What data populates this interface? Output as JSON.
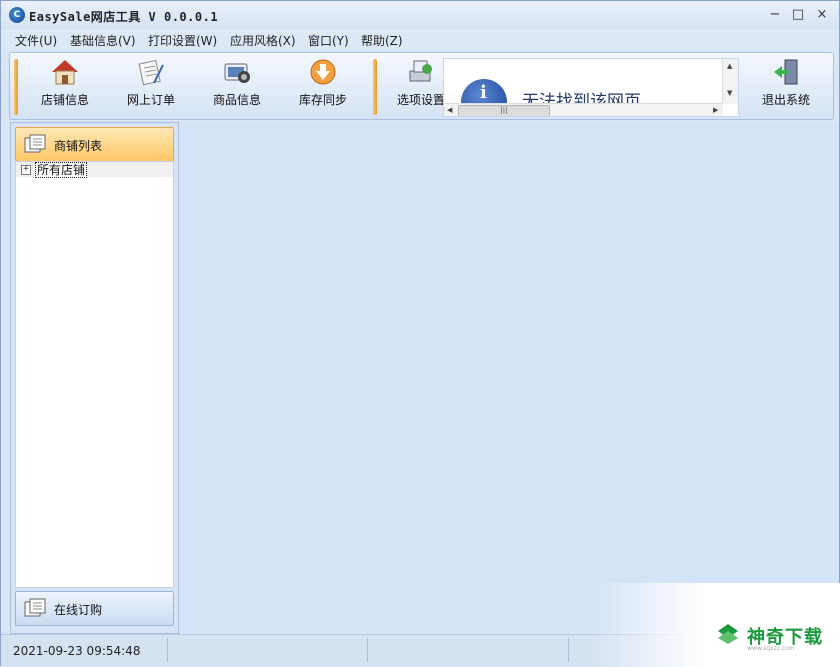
{
  "window": {
    "title": "EasySale网店工具 V 0.0.0.1",
    "app_icon_text": "C",
    "controls": {
      "minimize": "−",
      "maximize": "□",
      "close": "×"
    }
  },
  "menu": {
    "items": [
      "文件(U)",
      "基础信息(V)",
      "打印设置(W)",
      "应用风格(X)",
      "窗口(Y)",
      "帮助(Z)"
    ]
  },
  "toolbar": {
    "buttons": [
      {
        "label": "店铺信息",
        "icon": "house-icon"
      },
      {
        "label": "网上订单",
        "icon": "order-doc-icon"
      },
      {
        "label": "商品信息",
        "icon": "product-icon"
      },
      {
        "label": "库存同步",
        "icon": "sync-arrow-icon"
      },
      {
        "label": "选项设置",
        "icon": "settings-icon"
      },
      {
        "label": "退出系统",
        "icon": "exit-door-icon"
      }
    ],
    "web_panel": {
      "error_text": "无法找到该网页",
      "scroll_thumb": "|||"
    }
  },
  "left_panel": {
    "header_label": "商铺列表",
    "tree": [
      {
        "label": "所有店铺",
        "expander": "+"
      }
    ],
    "bottom_button_label": "在线订购"
  },
  "status": {
    "datetime": "2021-09-23 09:54:48"
  },
  "watermark": {
    "text": "神奇下载",
    "sub": "www.sqxzz.com"
  },
  "colors": {
    "accent_orange": "#ffc765",
    "panel_blue": "#d5e3f7",
    "watermark_green": "#1a9a3d"
  }
}
